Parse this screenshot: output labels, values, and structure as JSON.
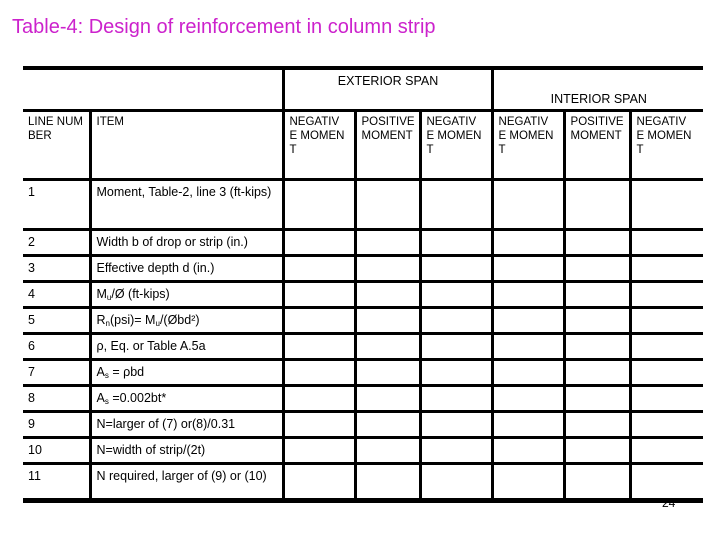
{
  "title": "Table-4: Design of reinforcement in column strip",
  "title_color": "#cc22cc",
  "table": {
    "group_headers": {
      "exterior": "EXTERIOR SPAN",
      "interior": "INTERIOR SPAN"
    },
    "columns": {
      "line_number": "LINE NUMBER",
      "item": "ITEM",
      "moments": [
        {
          "group": "exterior",
          "label": "NEGATIVE MOMENT"
        },
        {
          "group": "exterior",
          "label": "POSITIVE MOMENT"
        },
        {
          "group": "exterior",
          "label": "NEGATIVE MOMENT"
        },
        {
          "group": "interior",
          "label": "NEGATIVE MOMENT"
        },
        {
          "group": "interior",
          "label": "POSITIVE MOMENT"
        },
        {
          "group": "interior",
          "label": "NEGATIVE MOMENT"
        }
      ]
    },
    "rows": [
      {
        "line": "1",
        "item": "Moment, Table-2, line 3 (ft-kips)",
        "values": [
          "",
          "",
          "",
          "",
          "",
          ""
        ]
      },
      {
        "line": "2",
        "item": "Width b of drop or strip (in.)",
        "values": [
          "",
          "",
          "",
          "",
          "",
          ""
        ]
      },
      {
        "line": "3",
        "item": "Effective depth d (in.)",
        "values": [
          "",
          "",
          "",
          "",
          "",
          ""
        ]
      },
      {
        "line": "4",
        "item_parts": {
          "a": "M",
          "sub": "u",
          "b": "/Ø (ft-kips)"
        },
        "values": [
          "",
          "",
          "",
          "",
          "",
          ""
        ]
      },
      {
        "line": "5",
        "item_parts": {
          "a": "R",
          "sub": "n",
          "b": "(psi)= M",
          "sub2": "u",
          "c": "/(Øbd²)"
        },
        "values": [
          "",
          "",
          "",
          "",
          "",
          ""
        ]
      },
      {
        "line": "6",
        "item": "ρ, Eq. or Table A.5a",
        "values": [
          "",
          "",
          "",
          "",
          "",
          ""
        ]
      },
      {
        "line": "7",
        "item_parts": {
          "a": "A",
          "sub": "s",
          "b": " = ρbd"
        },
        "values": [
          "",
          "",
          "",
          "",
          "",
          ""
        ]
      },
      {
        "line": "8",
        "item_parts": {
          "a": "A",
          "sub": "s",
          "b": " =0.002bt*"
        },
        "values": [
          "",
          "",
          "",
          "",
          "",
          ""
        ]
      },
      {
        "line": "9",
        "item": "N=larger of (7) or(8)/0.31",
        "values": [
          "",
          "",
          "",
          "",
          "",
          ""
        ]
      },
      {
        "line": "10",
        "item": "N=width of strip/(2t)",
        "values": [
          "",
          "",
          "",
          "",
          "",
          ""
        ]
      },
      {
        "line": "11",
        "item": "N required, larger of (9) or (10)",
        "values": [
          "",
          "",
          "",
          "",
          "",
          ""
        ]
      }
    ]
  },
  "page_number": "24"
}
